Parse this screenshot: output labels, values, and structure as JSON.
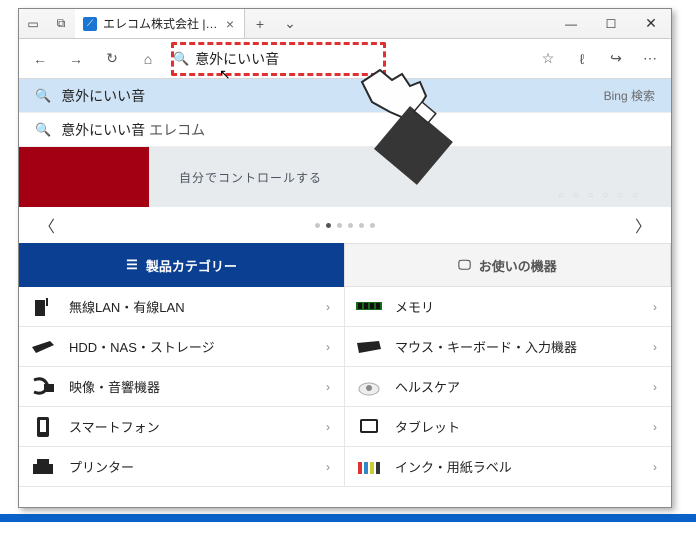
{
  "titlebar": {
    "tab_title": "エレコム株式会社 | ELECC",
    "favicon_glyph": "⟋"
  },
  "addressbar": {
    "value": "意外にいい音"
  },
  "suggestions": [
    {
      "text": "意外にいい音",
      "bing_label": "Bing 検索"
    },
    {
      "text_prefix": "意外にいい音 ",
      "text_em": "エレコム"
    }
  ],
  "banner": {
    "text": "自分でコントロールする"
  },
  "tabs": {
    "category": "製品カテゴリー",
    "device": "お使いの機器"
  },
  "categories_left": [
    {
      "label": "無線LAN・有線LAN",
      "icon": "router"
    },
    {
      "label": "HDD・NAS・ストレージ",
      "icon": "hdd"
    },
    {
      "label": "映像・音響機器",
      "icon": "av"
    },
    {
      "label": "スマートフォン",
      "icon": "phone"
    },
    {
      "label": "プリンター",
      "icon": "printer"
    }
  ],
  "categories_right": [
    {
      "label": "メモリ",
      "icon": "memory"
    },
    {
      "label": "マウス・キーボード・入力機器",
      "icon": "keyboard"
    },
    {
      "label": "ヘルスケア",
      "icon": "health"
    },
    {
      "label": "タブレット",
      "icon": "tablet"
    },
    {
      "label": "インク・用紙ラベル",
      "icon": "ink"
    }
  ]
}
